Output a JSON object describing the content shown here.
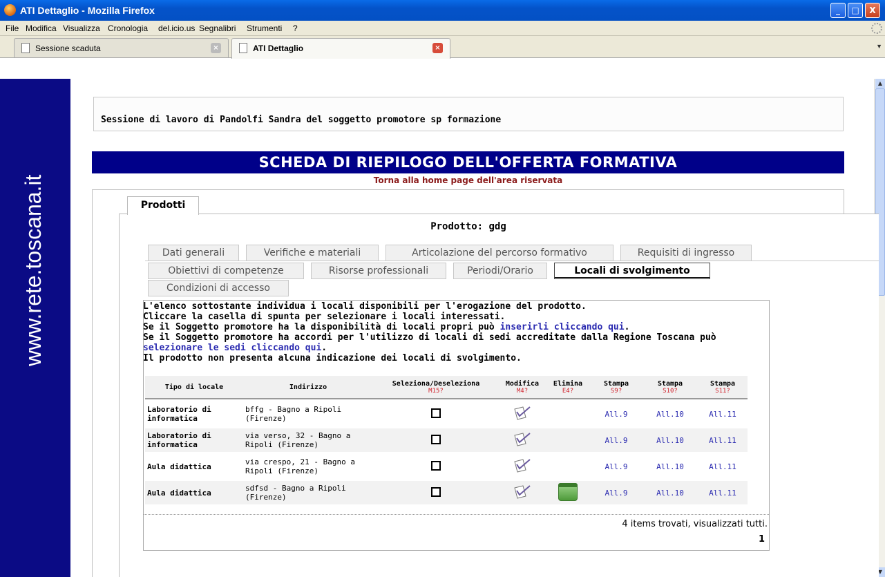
{
  "window": {
    "title": "ATI Dettaglio - Mozilla Firefox",
    "buttons": [
      "_",
      "□",
      "X"
    ]
  },
  "menu": [
    "File",
    "Modifica",
    "Visualizza",
    "Cronologia",
    "del.icio.us",
    "Segnalibri",
    "Strumenti",
    "?"
  ],
  "tabs": [
    {
      "label": "Sessione scaduta",
      "active": false
    },
    {
      "label": "ATI Dettaglio",
      "active": true
    }
  ],
  "sidebar": {
    "text": "www.rete.toscana.it"
  },
  "session": "Sessione di lavoro di Pandolfi Sandra del soggetto promotore sp formazione",
  "banner": "SCHEDA DI RIEPILOGO DELL'OFFERTA FORMATIVA",
  "home_link": "Torna alla home page dell'area riservata",
  "main_tab": "Prodotti",
  "product_title": "Prodotto: gdg",
  "subtabs": [
    "Dati generali",
    "Verifiche e materiali",
    "Articolazione del percorso formativo",
    "Requisiti di ingresso",
    "Obiettivi di competenze",
    "Risorse professionali",
    "Periodi/Orario",
    "Locali di svolgimento",
    "Condizioni di accesso"
  ],
  "description": {
    "line1": "L'elenco sottostante individua i locali disponibili per l'erogazione del prodotto.",
    "line2": "Cliccare la casella di spunta per selezionare i locali interessati.",
    "line3_pre": "Se il Soggetto promotore ha la disponibilità di locali propri può ",
    "line3_link": "inserirli cliccando qui",
    "line3_post": ".",
    "line4": "Se il Soggetto promotore ha accordi per l'utilizzo di locali di sedi accreditate dalla Regione Toscana può",
    "line5_link": "selezionare le sedi cliccando qui",
    "line5_post": ".",
    "line6": "Il prodotto non presenta alcuna indicazione dei locali di svolgimento."
  },
  "table": {
    "headers": [
      {
        "label": "Tipo di locale",
        "code": ""
      },
      {
        "label": "Indirizzo",
        "code": ""
      },
      {
        "label": "Seleziona/Deseleziona",
        "code": "M15?"
      },
      {
        "label": "Modifica",
        "code": "M4?"
      },
      {
        "label": "Elimina",
        "code": "E4?"
      },
      {
        "label": "Stampa",
        "code": "S9?"
      },
      {
        "label": "Stampa",
        "code": "S10?"
      },
      {
        "label": "Stampa",
        "code": "S11?"
      }
    ],
    "rows": [
      {
        "tipo": "Laboratorio di informatica",
        "indirizzo": "bffg - Bagno a Ripoli (Firenze)",
        "elimina": false,
        "all9": "All.9",
        "all10": "All.10",
        "all11": "All.11"
      },
      {
        "tipo": "Laboratorio di informatica",
        "indirizzo": "via verso, 32 - Bagno a Ripoli (Firenze)",
        "elimina": false,
        "all9": "All.9",
        "all10": "All.10",
        "all11": "All.11"
      },
      {
        "tipo": "Aula didattica",
        "indirizzo": "via crespo, 21 - Bagno a Ripoli (Firenze)",
        "elimina": false,
        "all9": "All.9",
        "all10": "All.10",
        "all11": "All.11"
      },
      {
        "tipo": "Aula didattica",
        "indirizzo": "sdfsd - Bagno a Ripoli (Firenze)",
        "elimina": true,
        "all9": "All.9",
        "all10": "All.10",
        "all11": "All.11"
      }
    ]
  },
  "footer": {
    "count": "4 items trovati, visualizzati tutti.",
    "page": "1"
  }
}
